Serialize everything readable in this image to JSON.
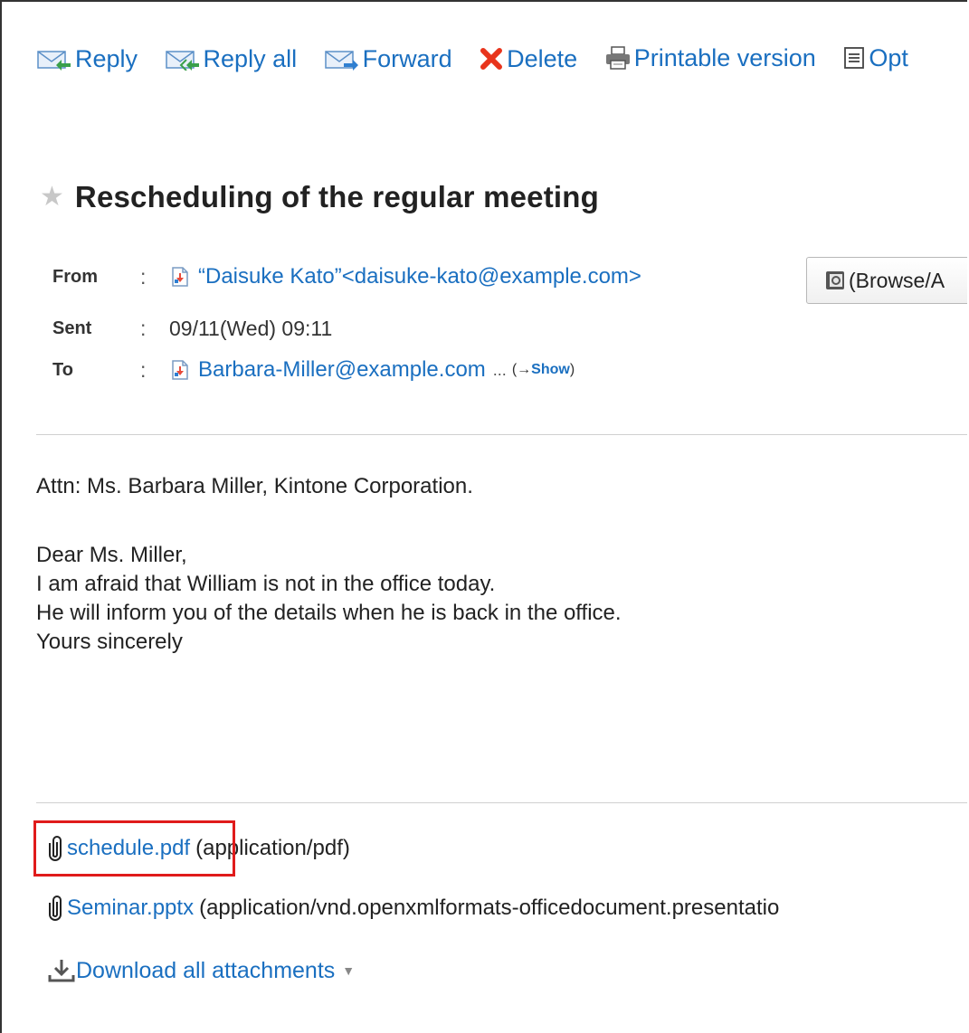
{
  "toolbar": {
    "reply": "Reply",
    "reply_all": "Reply all",
    "forward": "Forward",
    "delete": "Delete",
    "printable": "Printable version",
    "options": "Opt"
  },
  "message": {
    "subject": "Rescheduling of the regular meeting",
    "from_label": "From",
    "from_value": "“Daisuke Kato”<daisuke-kato@example.com>",
    "sent_label": "Sent",
    "sent_value": "09/11(Wed) 09:11",
    "to_label": "To",
    "to_value": "Barbara-Miller@example.com",
    "to_ellipsis": "...",
    "show_prefix": "(→",
    "show_link": "Show",
    "show_suffix": ")",
    "colon": ":",
    "browse_button": "(Browse/A"
  },
  "body": {
    "line1": "Attn: Ms. Barbara Miller, Kintone Corporation.",
    "line2": "Dear Ms. Miller,",
    "line3": "I am afraid that William is not in the office today.",
    "line4": "He will inform you of the details when he is back in the office.",
    "line5": "Yours sincerely"
  },
  "attachments": {
    "items": [
      {
        "name": "schedule.pdf",
        "type": "(application/pdf)"
      },
      {
        "name": "Seminar.pptx",
        "type": "(application/vnd.openxmlformats-officedocument.presentatio"
      }
    ],
    "download_all": "Download all attachments"
  },
  "colors": {
    "link": "#1a6fc0",
    "highlight": "#e01b1b",
    "delete_icon": "#e8341c"
  }
}
